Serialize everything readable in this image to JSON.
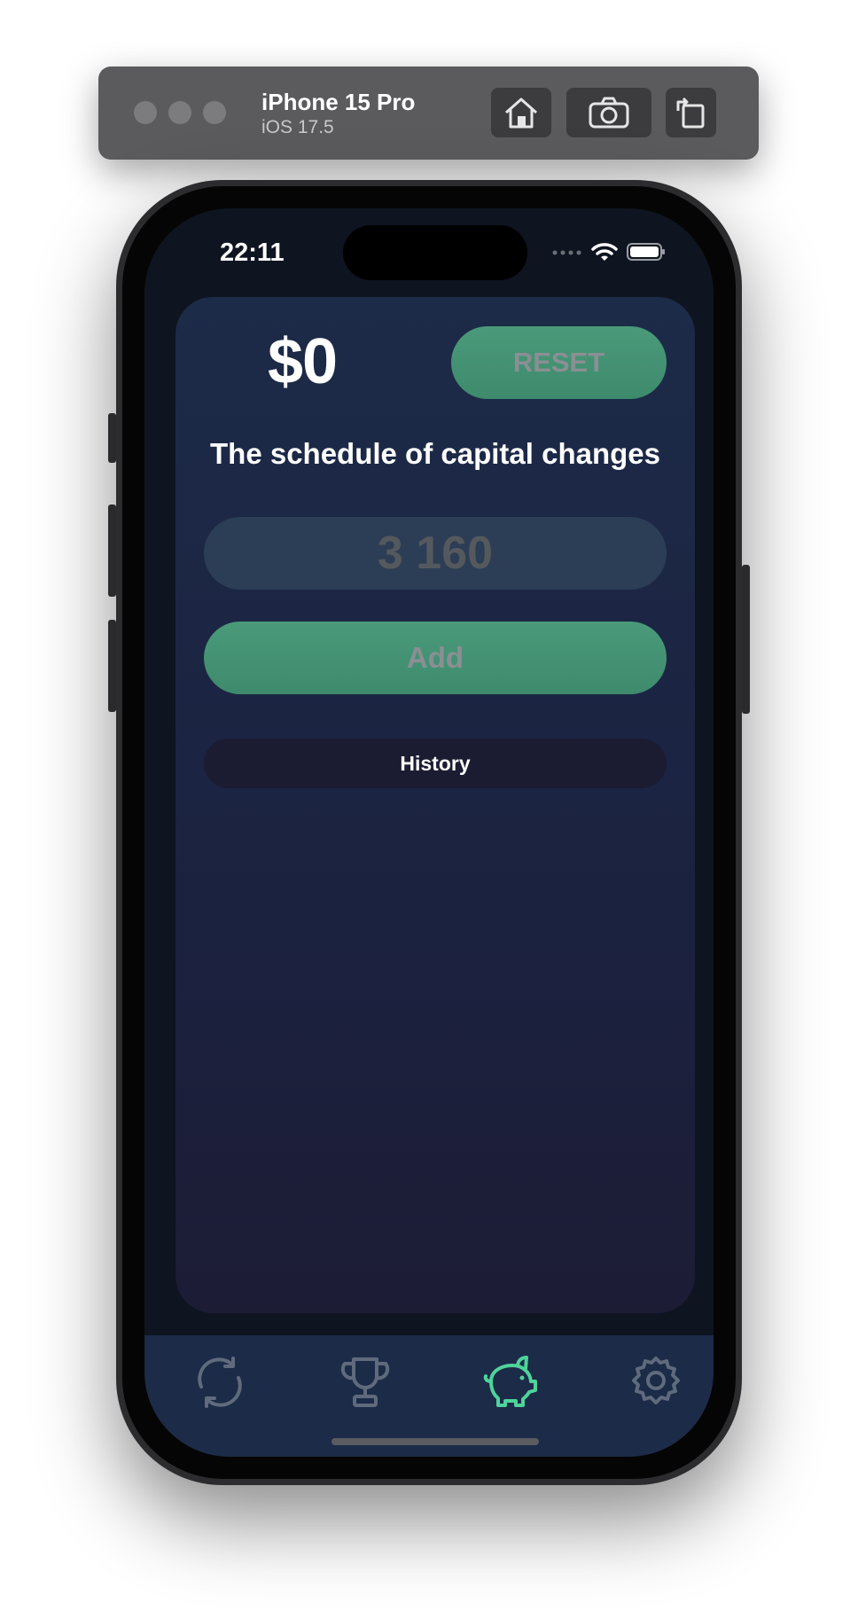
{
  "simulator": {
    "device_name": "iPhone 15 Pro",
    "os_version": "iOS 17.5",
    "buttons": [
      "home-icon",
      "camera-icon",
      "rotate-icon"
    ]
  },
  "status_bar": {
    "time": "22:11",
    "icons": [
      "signal-icon",
      "wifi-icon",
      "battery-icon"
    ]
  },
  "main": {
    "balance": "$0",
    "reset_label": "RESET",
    "heading": "The schedule of capital changes",
    "amount_placeholder": "3 160",
    "add_label": "Add",
    "history_label": "History"
  },
  "tabbar": {
    "tabs": [
      {
        "icon": "refresh-icon",
        "active": false
      },
      {
        "icon": "trophy-icon",
        "active": false
      },
      {
        "icon": "piggy-bank-icon",
        "active": true
      },
      {
        "icon": "gear-icon",
        "active": false
      }
    ]
  },
  "colors": {
    "accent": "#4fd39a",
    "button_green": "#449679",
    "card": "#1c2b48",
    "inactive_icon": "#5f6b7c"
  }
}
